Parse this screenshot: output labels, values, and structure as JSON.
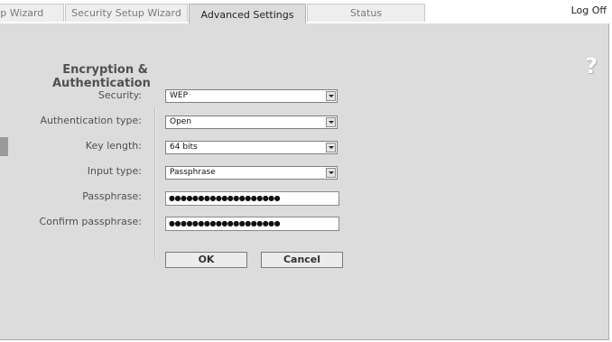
{
  "tabs": [
    {
      "label": "tup Wizard",
      "active": false
    },
    {
      "label": "Security Setup Wizard",
      "active": false
    },
    {
      "label": "Advanced Settings",
      "active": true
    },
    {
      "label": "Status",
      "active": false
    }
  ],
  "header": {
    "logoff_label": "Log Off",
    "help_icon": "question-mark-icon",
    "help_glyph": "?"
  },
  "section": {
    "title_line1": "Encryption &",
    "title_line2": "Authentication"
  },
  "form": {
    "security": {
      "label": "Security:",
      "value": "WEP"
    },
    "auth_type": {
      "label": "Authentication type:",
      "value": "Open"
    },
    "key_length": {
      "label": "Key length:",
      "value": "64 bits"
    },
    "input_type": {
      "label": "Input type:",
      "value": "Passphrase"
    },
    "passphrase": {
      "label": "Passphrase:",
      "value": "●●●●●●●●●●●●●●●●●●●"
    },
    "confirm_passphrase": {
      "label": "Confirm passphrase:",
      "value": "●●●●●●●●●●●●●●●●●●●"
    }
  },
  "buttons": {
    "ok_label": "OK",
    "cancel_label": "Cancel"
  },
  "colors": {
    "panel_bg": "#dcdcdc",
    "active_tab_bg": "#dcdcdc",
    "inactive_tab_bg": "#eeeeee"
  }
}
